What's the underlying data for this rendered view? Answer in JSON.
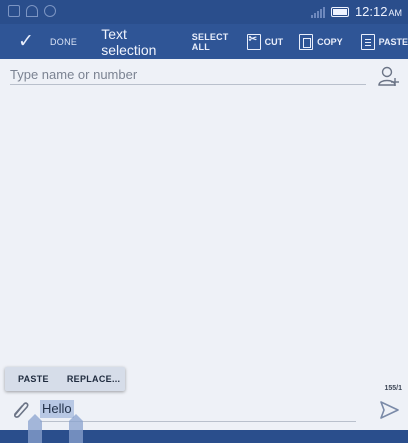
{
  "status_bar": {
    "time": "12:12",
    "ampm": "AM"
  },
  "action_bar": {
    "done_label": "DONE",
    "title": "Text selection",
    "select_all_label": "SELECT ALL",
    "cut_label": "CUT",
    "copy_label": "COPY",
    "paste_label": "PASTE"
  },
  "recipient": {
    "placeholder": "Type name or number",
    "value": ""
  },
  "popup_menu": {
    "paste_label": "PASTE",
    "replace_label": "REPLACE..."
  },
  "composer": {
    "char_counter": "155/1",
    "text": "Hello"
  },
  "icons": {
    "done": "check-icon",
    "cut": "cut-icon",
    "copy": "copy-icon",
    "paste": "paste-icon",
    "add_contact": "add-contact-icon",
    "attach": "paperclip-icon",
    "send": "send-icon"
  },
  "colors": {
    "status_bar": "#2a4e8c",
    "action_bar": "#2f5596",
    "background": "#eef1f7",
    "selection_highlight": "#b8c8e4",
    "handle": "#8aa3cf"
  }
}
